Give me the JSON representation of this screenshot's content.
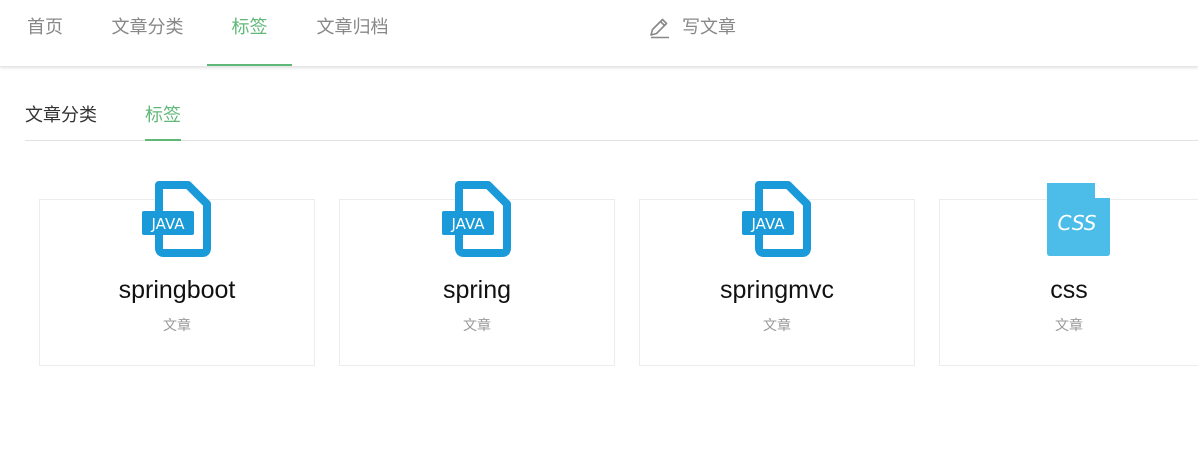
{
  "colors": {
    "accent": "#5fb878",
    "nav_text": "#888888",
    "java_icon": "#1a9ad8",
    "css_icon": "#4cbde9"
  },
  "nav": {
    "items": [
      {
        "label": "首页"
      },
      {
        "label": "文章分类"
      },
      {
        "label": "标签",
        "active": true
      },
      {
        "label": "文章归档"
      }
    ],
    "write_label": "写文章",
    "write_icon": "pencil-icon"
  },
  "subtabs": {
    "items": [
      {
        "label": "文章分类"
      },
      {
        "label": "标签",
        "active": true
      }
    ]
  },
  "tags": [
    {
      "name": "springboot",
      "icon_text": "JAVA",
      "icon": "java-file-icon",
      "count_label": "文章"
    },
    {
      "name": "spring",
      "icon_text": "JAVA",
      "icon": "java-file-icon",
      "count_label": "文章"
    },
    {
      "name": "springmvc",
      "icon_text": "JAVA",
      "icon": "java-file-icon",
      "count_label": "文章"
    },
    {
      "name": "css",
      "icon_text": "CSS",
      "icon": "css-file-icon",
      "count_label": "文章"
    }
  ]
}
